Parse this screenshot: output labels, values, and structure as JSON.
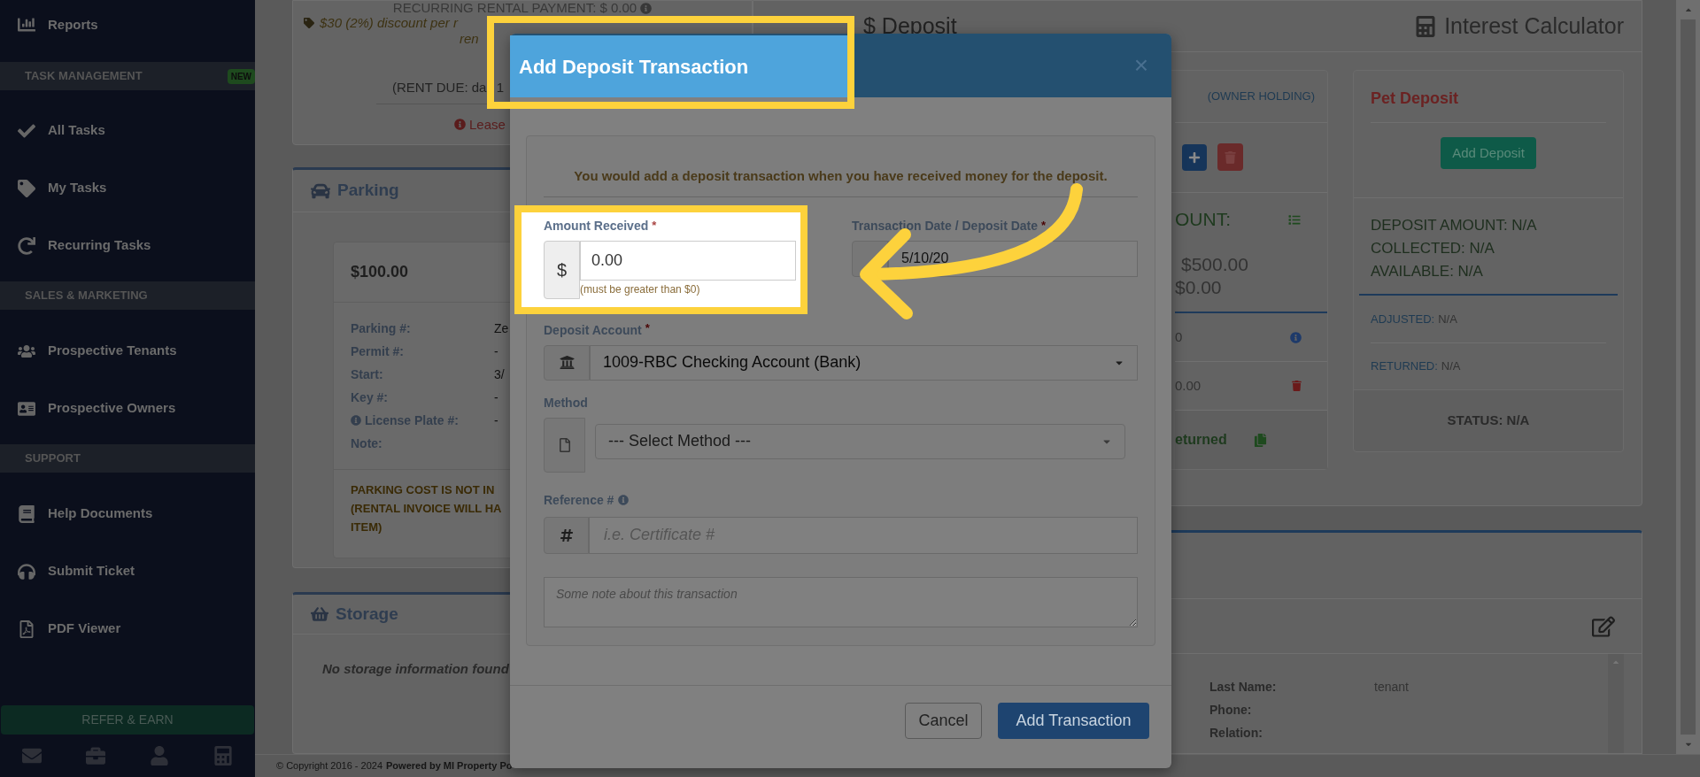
{
  "sidebar": {
    "items": [
      {
        "kind": "link",
        "label": "Reports"
      },
      {
        "kind": "section",
        "label": "TASK MANAGEMENT",
        "badge": "NEW"
      },
      {
        "kind": "link",
        "label": "All Tasks"
      },
      {
        "kind": "link",
        "label": "My Tasks"
      },
      {
        "kind": "link",
        "label": "Recurring Tasks"
      },
      {
        "kind": "section",
        "label": "SALES & MARKETING"
      },
      {
        "kind": "link",
        "label": "Prospective Tenants"
      },
      {
        "kind": "link",
        "label": "Prospective Owners"
      },
      {
        "kind": "section",
        "label": "SUPPORT"
      },
      {
        "kind": "link",
        "label": "Help Documents"
      },
      {
        "kind": "link",
        "label": "Submit Ticket"
      },
      {
        "kind": "link",
        "label": "PDF Viewer"
      }
    ],
    "refer_button": "REFER & EARN"
  },
  "rental_card": {
    "recurring": "RECURRING RENTAL PAYMENT: $ 0.00",
    "discount_line_1": "$30 (2%) discount per r",
    "discount_line_2": "ren",
    "rent_due": "(RENT DUE: da",
    "rent_due_tail": "1",
    "lease": "Lease"
  },
  "parking": {
    "title": "Parking",
    "amount": "$100.00",
    "rows": [
      {
        "label": "Parking #:",
        "value": "Ze",
        "info": false
      },
      {
        "label": "Permit #:",
        "value": "-",
        "info": false
      },
      {
        "label": "Start:",
        "value": "3/",
        "info": false
      },
      {
        "label": "Key #:",
        "value": "-",
        "info": false
      },
      {
        "label": "License Plate #:",
        "value": "-",
        "info": true
      },
      {
        "label": "Note:",
        "info": false
      }
    ],
    "note_lines": [
      "PARKING COST IS NOT IN",
      "(RENTAL INVOICE WILL HA",
      "ITEM)"
    ]
  },
  "storage": {
    "title": "Storage",
    "empty": "No storage information found"
  },
  "footer": {
    "copyright": "© Copyright 2016 - 2024",
    "powered": "Powered by MI Property Po"
  },
  "deposit": {
    "title": "$ Deposit",
    "calculator": "Interest Calculator",
    "card_1": {
      "holding": "(OWNER HOLDING)",
      "amount_label": "OUNT:",
      "line_1": "$500.00",
      "line_2": "$0.00",
      "row_1": "0",
      "row_2": "0.00",
      "returned": "eturned"
    },
    "pet_card": {
      "title": "Pet Deposit",
      "button": "Add Deposit",
      "amount": "DEPOSIT AMOUNT: N/A",
      "collected": "COLLECTED: N/A",
      "available": "AVAILABLE: N/A",
      "adjusted_label": "ADJUSTED:",
      "adjusted": "N/A",
      "returned_label": "RETURNED:",
      "returned": "N/A",
      "status": "STATUS: N/A"
    }
  },
  "contact": {
    "rows": [
      {
        "label": "Last Name:",
        "value": "tenant"
      },
      {
        "label": "Phone:"
      },
      {
        "label": "Relation:"
      }
    ]
  },
  "modal": {
    "title": "Add Deposit Transaction",
    "close": "×",
    "intro": "You would add a deposit transaction when you have received money for the deposit.",
    "amount": {
      "label": "Amount Received",
      "required_mark": "*",
      "addon": "$",
      "value": "0.00",
      "help": "(must be greater than $0)"
    },
    "date": {
      "label": "Transaction Date / Deposit Date",
      "required_mark": "*",
      "value": "5/10/20"
    },
    "account": {
      "label": "Deposit Account",
      "required_mark": "*",
      "value": "1009-RBC Checking Account (Bank)"
    },
    "method": {
      "label": "Method",
      "value": "--- Select Method ---"
    },
    "reference": {
      "label": "Reference #",
      "placeholder": "i.e. Certificate #"
    },
    "note": {
      "placeholder": "Some note about this transaction"
    },
    "buttons": {
      "cancel": "Cancel",
      "submit": "Add Transaction"
    }
  }
}
